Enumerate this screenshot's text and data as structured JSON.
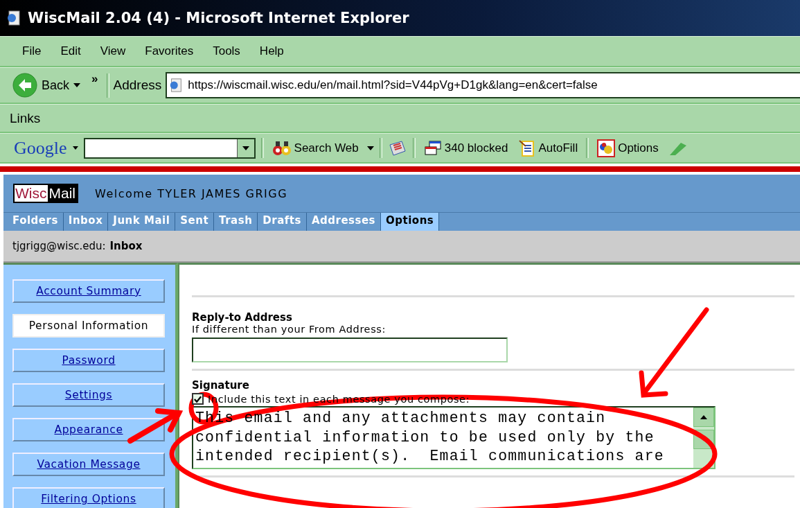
{
  "window": {
    "title": "WiscMail 2.04 (4) - Microsoft Internet Explorer"
  },
  "menu": [
    "File",
    "Edit",
    "View",
    "Favorites",
    "Tools",
    "Help"
  ],
  "nav": {
    "back": "Back",
    "more": "»"
  },
  "address": {
    "label": "Address",
    "url": "https://wiscmail.wisc.edu/en/mail.html?sid=V44pVg+D1gk&lang=en&cert=false"
  },
  "links": {
    "label": "Links"
  },
  "google_toolbar": {
    "logo": "Google",
    "search_web": "Search Web",
    "blocked": "340 blocked",
    "autofill": "AutoFill",
    "options": "Options"
  },
  "header": {
    "logo_left": "Wisc",
    "logo_right": "Mail",
    "welcome": "Welcome TYLER JAMES GRIGG"
  },
  "tabs": [
    {
      "label": "Folders",
      "selected": false
    },
    {
      "label": "Inbox",
      "selected": false
    },
    {
      "label": "Junk Mail",
      "selected": false
    },
    {
      "label": "Sent",
      "selected": false
    },
    {
      "label": "Trash",
      "selected": false
    },
    {
      "label": "Drafts",
      "selected": false
    },
    {
      "label": "Addresses",
      "selected": false
    },
    {
      "label": "Options",
      "selected": true
    }
  ],
  "location": {
    "account": "tjgrigg@wisc.edu:",
    "folder": "Inbox"
  },
  "sidebar": {
    "items": [
      {
        "label": "Account Summary",
        "selected": false
      },
      {
        "label": "Personal Information",
        "selected": true
      },
      {
        "label": "Password",
        "selected": false
      },
      {
        "label": "Settings",
        "selected": false
      },
      {
        "label": "Appearance",
        "selected": false
      },
      {
        "label": "Vacation Message",
        "selected": false
      },
      {
        "label": "Filtering Options",
        "selected": false
      }
    ]
  },
  "form": {
    "reply_to": {
      "title": "Reply-to Address",
      "hint": "If different than your From Address:"
    },
    "signature": {
      "title": "Signature",
      "include_label": "Include this text in each message you compose:",
      "checked": true,
      "lines": [
        "This email and any attachments may contain",
        "confidential information to be used only by the",
        "intended recipient(s).  Email communications are"
      ]
    }
  }
}
